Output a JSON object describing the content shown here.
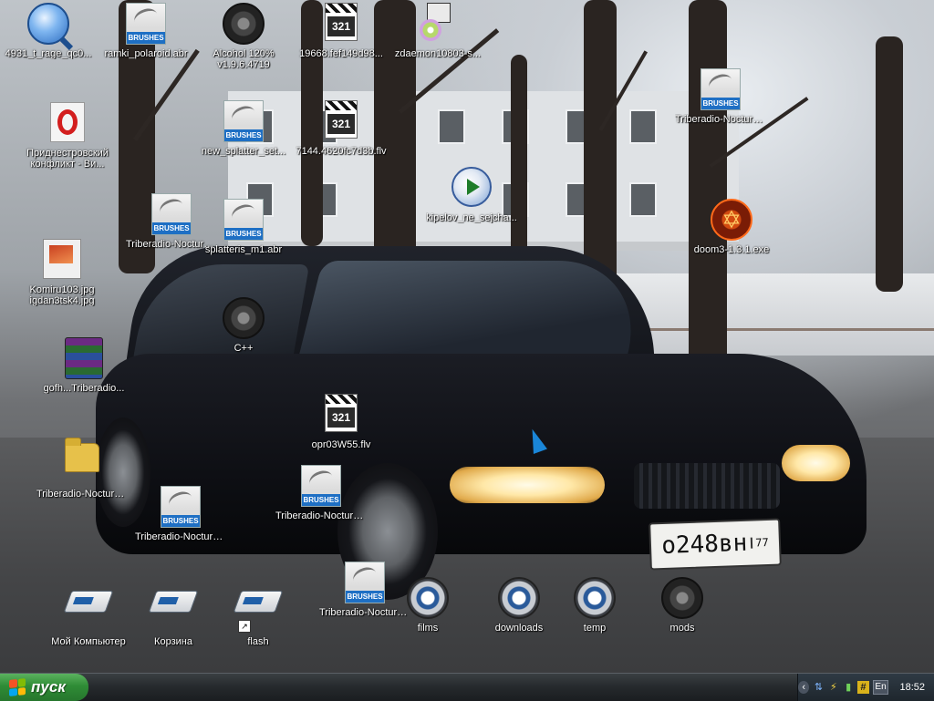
{
  "desktop": {
    "car_plate": {
      "number": "о248вн",
      "region": "77"
    },
    "icons": [
      {
        "label": "4931_t_rage_qc0...",
        "icon": "quicktime-icon"
      },
      {
        "label": "ramki_polaroid.abr",
        "icon": "brushes-icon"
      },
      {
        "label": "Alcohol 120%\nv1.9.6.4719",
        "icon": "alcohol-disc-icon"
      },
      {
        "label": "19668.fef149d98...",
        "icon": "video-clapper-icon"
      },
      {
        "label": "zdaemon10803-s...",
        "icon": "setup-icon"
      },
      {
        "label": "Приднестровский конфликт - Ви...",
        "icon": "opera-icon"
      },
      {
        "label": "new_splatter_set...",
        "icon": "brushes-icon"
      },
      {
        "label": "7144.4620fc7d3b.flv",
        "icon": "video-clapper-icon"
      },
      {
        "label": "Triberadio-Nocturn...",
        "icon": "brushes-icon"
      },
      {
        "label": "kipelov_ne_sejcha...",
        "icon": "media-player-icon"
      },
      {
        "label": "Triberadio-Nocturn...",
        "icon": "brushes-icon"
      },
      {
        "label": "splatteris_m1.abr",
        "icon": "brushes-icon"
      },
      {
        "label": "doom3-1.3.1.exe",
        "icon": "pentagram-icon"
      },
      {
        "label": "Komiru103.jpg\nigdan3tsk4.jpg",
        "icon": "image-icon"
      },
      {
        "label": "C++",
        "icon": "disc-dark-icon"
      },
      {
        "label": "gofh...Triberadio...",
        "icon": "winrar-icon"
      },
      {
        "label": "opr03W55.flv",
        "icon": "video-clapper-icon"
      },
      {
        "label": "Triberadio-Nocturn...",
        "icon": "folder-icon"
      },
      {
        "label": "Triberadio-Nocturn...",
        "icon": "brushes-icon"
      },
      {
        "label": "Triberadio-Nocturn...",
        "icon": "brushes-icon"
      },
      {
        "label": "Мой Компьютер",
        "icon": "my-computer-icon"
      },
      {
        "label": "Корзина",
        "icon": "recycle-bin-icon"
      },
      {
        "label": "flash",
        "icon": "drive-shortcut-icon"
      },
      {
        "label": "Triberadio-Nocturn...",
        "icon": "brushes-icon"
      },
      {
        "label": "films",
        "icon": "disc-icon"
      },
      {
        "label": "downloads",
        "icon": "disc-icon"
      },
      {
        "label": "temp",
        "icon": "disc-icon"
      },
      {
        "label": "mods",
        "icon": "disc-dark-icon"
      }
    ],
    "brushes_text": "BRUSHES",
    "video_badge": "321"
  },
  "taskbar": {
    "start_label": "пуск",
    "tray": {
      "language": "En",
      "clock": "18:52",
      "icons": [
        "collapse-arrow-icon",
        "network-icon",
        "lightning-icon",
        "battery-icon",
        "hash-icon"
      ]
    }
  },
  "colors": {
    "start_green": "#2f8c36",
    "taskbar_dark": "#25292c",
    "brush_blue": "#1e6fc4"
  }
}
